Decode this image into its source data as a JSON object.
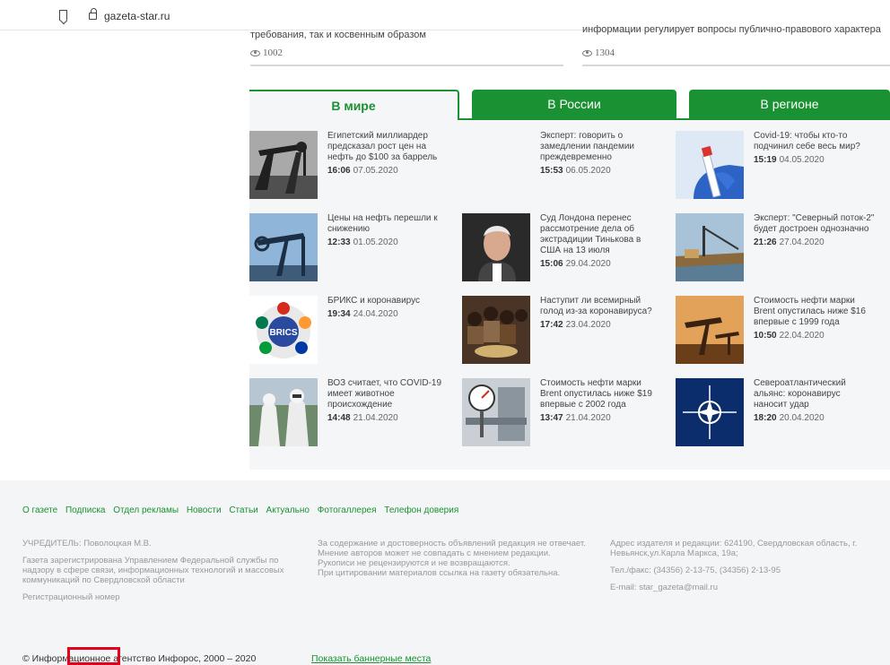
{
  "browser": {
    "url": "gazeta-star.ru"
  },
  "top_stubs": [
    {
      "text": "требования, так и косвенным образом",
      "views": "1002"
    },
    {
      "text": "информации регулирует вопросы публично-правового характера",
      "views": "1304"
    }
  ],
  "tabs": [
    {
      "label": "В мире"
    },
    {
      "label": "В России"
    },
    {
      "label": "В регионе"
    }
  ],
  "news": [
    {
      "title": "Египетский миллиардер предсказал рост цен на нефть до $100 за баррель",
      "time": "16:06",
      "date": "07.05.2020",
      "image": "oil-pumps-image"
    },
    {
      "title": "Эксперт: говорить о замедлении пандемии преждевременно",
      "time": "15:53",
      "date": "06.05.2020",
      "image": ""
    },
    {
      "title": "Covid-19: чтобы кто-то подчинил себе весь мир?",
      "time": "15:19",
      "date": "04.05.2020",
      "image": "test-tube-image"
    },
    {
      "title": "Цены на нефть перешли к снижению",
      "time": "12:33",
      "date": "01.05.2020",
      "image": "oil-pump-image"
    },
    {
      "title": "Суд Лондона перенес рассмотрение дела об экстрадиции Тинькова в США на 13 июля",
      "time": "15:06",
      "date": "29.04.2020",
      "image": "man-portrait-image"
    },
    {
      "title": "Эксперт: \"Северный поток-2\" будет достроен однозначно",
      "time": "21:26",
      "date": "27.04.2020",
      "image": "pipe-ship-image"
    },
    {
      "title": "БРИКС и коронавирус",
      "time": "19:34",
      "date": "24.04.2020",
      "image": "brics-logo-image"
    },
    {
      "title": "Наступит ли всемирный голод из-за коронавируса?",
      "time": "17:42",
      "date": "23.04.2020",
      "image": "children-image"
    },
    {
      "title": "Стоимость нефти марки Brent опустилась ниже $16 впервые с 1999 года",
      "time": "10:50",
      "date": "22.04.2020",
      "image": "oil-field-image"
    },
    {
      "title": "ВОЗ считает, что COVID-19 имеет животное происхождение",
      "time": "14:48",
      "date": "21.04.2020",
      "image": "hazmat-image"
    },
    {
      "title": "Стоимость нефти марки Brent опустилась ниже $19 впервые с 2002 года",
      "time": "13:47",
      "date": "21.04.2020",
      "image": "gauge-image"
    },
    {
      "title": "Североатлантический альянс: коронавирус наносит удар",
      "time": "18:20",
      "date": "20.04.2020",
      "image": "nato-image"
    }
  ],
  "brics_label": "BRICS",
  "footer": {
    "nav": [
      "О газете",
      "Подписка",
      "Отдел рекламы",
      "Новости",
      "Статьи",
      "Актуально",
      "Фотогаллерея",
      "Телефон доверия"
    ],
    "col1": [
      "УЧРЕДИТЕЛЬ: Поволоцкая М.В.",
      "Газета зарегистрирована Управлением Федеральной службы по надзору в сфере связи, информационных технологий и массовых коммуникаций по Свердловской области",
      "Регистрационный номер"
    ],
    "col2": [
      "За содержание и достоверность объявлений редакция не отвечает.",
      "Мнение авторов может не совпадать с мнением редакции.",
      "Рукописи не рецензируются и не возвращаются.",
      "При цитировании материалов ссылка на газету обязательна."
    ],
    "col3": [
      "Адрес издателя и редакции: 624190, Свердловская область, г. Невьянск,ул.Карла Маркса, 19а;",
      "Тел./факс: (34356) 2-13-75, (34356) 2-13-95",
      "E-mail: star_gazeta@mail.ru"
    ],
    "copyright": "© Информационное агентство Инфорос, 2000 – 2020",
    "banner_link": "Показать баннерные места"
  },
  "colors": {
    "accent": "#1a9133",
    "highlight": "#e3001b"
  }
}
